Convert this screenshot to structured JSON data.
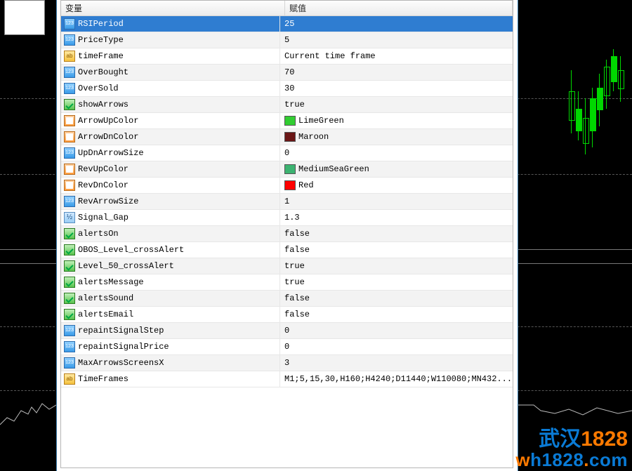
{
  "columns": {
    "variable": "变量",
    "value": "赋值"
  },
  "selected_index": 0,
  "rows": [
    {
      "icon": "int",
      "name": "RSIPeriod",
      "value": "25"
    },
    {
      "icon": "int",
      "name": "PriceType",
      "value": "5"
    },
    {
      "icon": "str",
      "name": "timeFrame",
      "value": "Current time frame"
    },
    {
      "icon": "int",
      "name": "OverBought",
      "value": "70"
    },
    {
      "icon": "int",
      "name": "OverSold",
      "value": "30"
    },
    {
      "icon": "bool",
      "name": "showArrows",
      "value": "true"
    },
    {
      "icon": "color",
      "name": "ArrowUpColor",
      "value": "LimeGreen",
      "swatch": "#32cd32"
    },
    {
      "icon": "color",
      "name": "ArrowDnColor",
      "value": "Maroon",
      "swatch": "#6a1616"
    },
    {
      "icon": "int",
      "name": "UpDnArrowSize",
      "value": "0"
    },
    {
      "icon": "color",
      "name": "RevUpColor",
      "value": "MediumSeaGreen",
      "swatch": "#3cb371"
    },
    {
      "icon": "color",
      "name": "RevDnColor",
      "value": "Red",
      "swatch": "#ff0000"
    },
    {
      "icon": "int",
      "name": "RevArrowSize",
      "value": "1"
    },
    {
      "icon": "float",
      "name": "Signal_Gap",
      "value": "1.3"
    },
    {
      "icon": "bool",
      "name": "alertsOn",
      "value": "false"
    },
    {
      "icon": "bool",
      "name": "OBOS_Level_crossAlert",
      "value": "false"
    },
    {
      "icon": "bool",
      "name": "Level_50_crossAlert",
      "value": "true"
    },
    {
      "icon": "bool",
      "name": "alertsMessage",
      "value": "true"
    },
    {
      "icon": "bool",
      "name": "alertsSound",
      "value": "false"
    },
    {
      "icon": "bool",
      "name": "alertsEmail",
      "value": "false"
    },
    {
      "icon": "int",
      "name": "repaintSignalStep",
      "value": "0"
    },
    {
      "icon": "int",
      "name": "repaintSignalPrice",
      "value": "0"
    },
    {
      "icon": "int",
      "name": "MaxArrowsScreensX",
      "value": "3"
    },
    {
      "icon": "str",
      "name": "TimeFrames",
      "value": "M1;5,15,30,H160;H4240;D11440;W110080;MN432..."
    }
  ],
  "icon_names": {
    "int": "type-integer-icon",
    "str": "type-string-icon",
    "bool": "type-bool-icon",
    "color": "type-color-icon",
    "float": "type-double-icon"
  },
  "brand": {
    "line1_cn": "武汉",
    "line1_num": "1828",
    "line2": "wh1828.com"
  }
}
